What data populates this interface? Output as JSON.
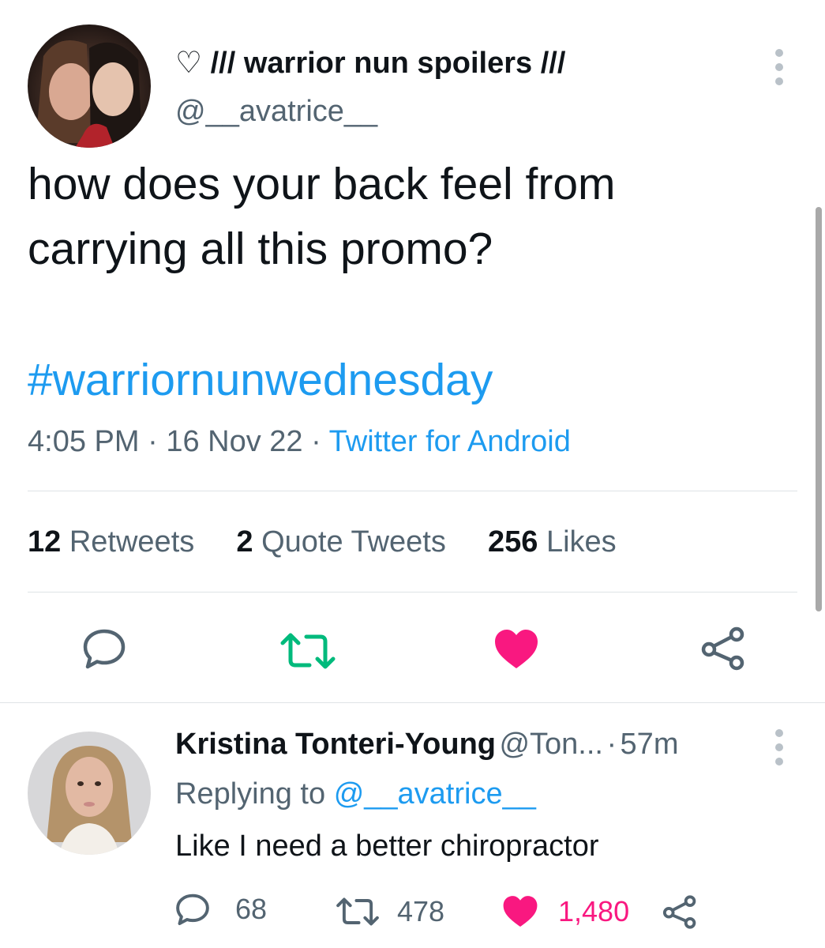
{
  "tweet": {
    "display_name": "♡ /// warrior nun spoilers ///",
    "handle": "@__avatrice__",
    "text_line1": "how does your back feel from",
    "text_line2": "carrying all this promo?",
    "hashtag": "#warriornunwednesday",
    "time": "4:05 PM",
    "sep": " · ",
    "date": "16 Nov 22",
    "source": "Twitter for Android",
    "stats": {
      "retweets_count": "12",
      "retweets_label": "Retweets",
      "quotes_count": "2",
      "quotes_label": "Quote Tweets",
      "likes_count": "256",
      "likes_label": "Likes"
    },
    "actions": {
      "reply_icon": "reply-icon",
      "retweet_icon": "retweet-icon",
      "like_icon": "heart-icon",
      "share_icon": "share-icon"
    }
  },
  "reply": {
    "display_name": "Kristina Tonteri-Young",
    "handle": "@Ton...",
    "dot": "·",
    "time": "57m",
    "replying_prefix": "Replying to",
    "replying_handle": "@__avatrice__",
    "text": "Like I need a better chiropractor",
    "reply_count": "68",
    "retweet_count": "478",
    "like_count": "1,480"
  },
  "colors": {
    "accent": "#1d9bf0",
    "retweet_green": "#00ba7c",
    "like_pink": "#f91880",
    "secondary_text": "#536471"
  }
}
